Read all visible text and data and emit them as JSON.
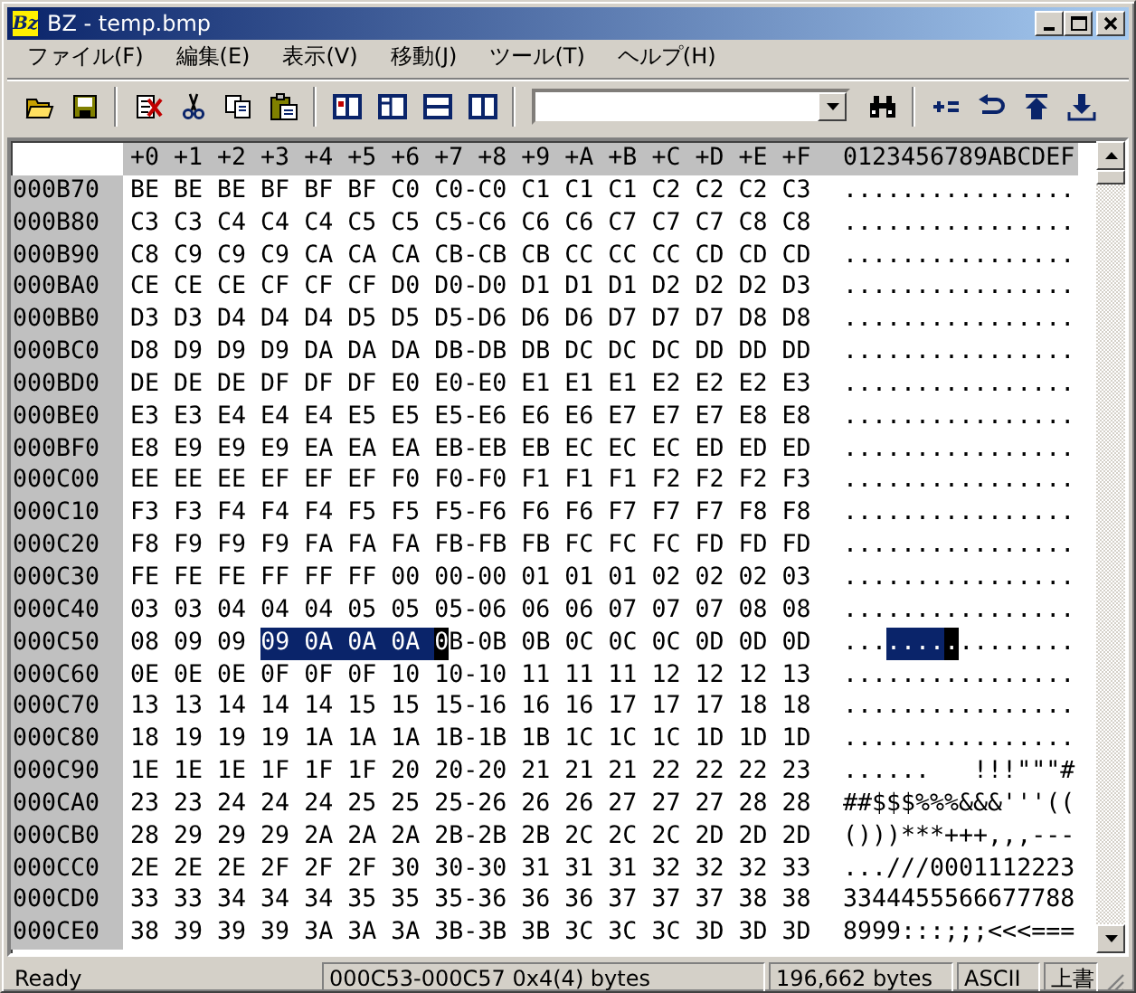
{
  "window": {
    "icon_label": "Bz",
    "title": "BZ - temp.bmp"
  },
  "menu": [
    {
      "label": "ファイル(F)"
    },
    {
      "label": "編集(E)"
    },
    {
      "label": "表示(V)"
    },
    {
      "label": "移動(J)"
    },
    {
      "label": "ツール(T)"
    },
    {
      "label": "ヘルプ(H)"
    }
  ],
  "hex_view": {
    "header": {
      "offsets": "+0 +1 +2 +3 +4 +5 +6 +7 +8 +9 +A +B +C +D +E +F",
      "ascii": "0123456789ABCDEF"
    },
    "rows": [
      {
        "address": "000B70",
        "hex": [
          {
            "kind": "plain",
            "text": "BE BE BE BF BF BF C0 C0-C0 C1 C1 C1 C2 C2 C2 C3"
          }
        ],
        "ascii": [
          {
            "kind": "plain",
            "text": "................"
          }
        ]
      },
      {
        "address": "000B80",
        "hex": [
          {
            "kind": "plain",
            "text": "C3 C3 C4 C4 C4 C5 C5 C5-C6 C6 C6 C7 C7 C7 C8 C8"
          }
        ],
        "ascii": [
          {
            "kind": "plain",
            "text": "................"
          }
        ]
      },
      {
        "address": "000B90",
        "hex": [
          {
            "kind": "plain",
            "text": "C8 C9 C9 C9 CA CA CA CB-CB CB CC CC CC CD CD CD"
          }
        ],
        "ascii": [
          {
            "kind": "plain",
            "text": "................"
          }
        ]
      },
      {
        "address": "000BA0",
        "hex": [
          {
            "kind": "plain",
            "text": "CE CE CE CF CF CF D0 D0-D0 D1 D1 D1 D2 D2 D2 D3"
          }
        ],
        "ascii": [
          {
            "kind": "plain",
            "text": "................"
          }
        ]
      },
      {
        "address": "000BB0",
        "hex": [
          {
            "kind": "plain",
            "text": "D3 D3 D4 D4 D4 D5 D5 D5-D6 D6 D6 D7 D7 D7 D8 D8"
          }
        ],
        "ascii": [
          {
            "kind": "plain",
            "text": "................"
          }
        ]
      },
      {
        "address": "000BC0",
        "hex": [
          {
            "kind": "plain",
            "text": "D8 D9 D9 D9 DA DA DA DB-DB DB DC DC DC DD DD DD"
          }
        ],
        "ascii": [
          {
            "kind": "plain",
            "text": "................"
          }
        ]
      },
      {
        "address": "000BD0",
        "hex": [
          {
            "kind": "plain",
            "text": "DE DE DE DF DF DF E0 E0-E0 E1 E1 E1 E2 E2 E2 E3"
          }
        ],
        "ascii": [
          {
            "kind": "plain",
            "text": "................"
          }
        ]
      },
      {
        "address": "000BE0",
        "hex": [
          {
            "kind": "plain",
            "text": "E3 E3 E4 E4 E4 E5 E5 E5-E6 E6 E6 E7 E7 E7 E8 E8"
          }
        ],
        "ascii": [
          {
            "kind": "plain",
            "text": "................"
          }
        ]
      },
      {
        "address": "000BF0",
        "hex": [
          {
            "kind": "plain",
            "text": "E8 E9 E9 E9 EA EA EA EB-EB EB EC EC EC ED ED ED"
          }
        ],
        "ascii": [
          {
            "kind": "plain",
            "text": "................"
          }
        ]
      },
      {
        "address": "000C00",
        "hex": [
          {
            "kind": "plain",
            "text": "EE EE EE EF EF EF F0 F0-F0 F1 F1 F1 F2 F2 F2 F3"
          }
        ],
        "ascii": [
          {
            "kind": "plain",
            "text": "................"
          }
        ]
      },
      {
        "address": "000C10",
        "hex": [
          {
            "kind": "plain",
            "text": "F3 F3 F4 F4 F4 F5 F5 F5-F6 F6 F6 F7 F7 F7 F8 F8"
          }
        ],
        "ascii": [
          {
            "kind": "plain",
            "text": "................"
          }
        ]
      },
      {
        "address": "000C20",
        "hex": [
          {
            "kind": "plain",
            "text": "F8 F9 F9 F9 FA FA FA FB-FB FB FC FC FC FD FD FD"
          }
        ],
        "ascii": [
          {
            "kind": "plain",
            "text": "................"
          }
        ]
      },
      {
        "address": "000C30",
        "hex": [
          {
            "kind": "plain",
            "text": "FE FE FE FF FF FF 00 00-00 01 01 01 02 02 02 03"
          }
        ],
        "ascii": [
          {
            "kind": "plain",
            "text": "................"
          }
        ]
      },
      {
        "address": "000C40",
        "hex": [
          {
            "kind": "plain",
            "text": "03 03 04 04 04 05 05 05-06 06 06 07 07 07 08 08"
          }
        ],
        "ascii": [
          {
            "kind": "plain",
            "text": "................"
          }
        ]
      },
      {
        "address": "000C50",
        "hex": [
          {
            "kind": "plain",
            "text": "08 09 09 "
          },
          {
            "kind": "selected",
            "text": "09 0A 0A 0A "
          },
          {
            "kind": "cursor",
            "text": "0"
          },
          {
            "kind": "plain",
            "text": "B-0B 0B 0C 0C 0C 0D 0D 0D"
          }
        ],
        "ascii": [
          {
            "kind": "plain",
            "text": "..."
          },
          {
            "kind": "selected",
            "text": "...."
          },
          {
            "kind": "cursor",
            "text": "."
          },
          {
            "kind": "plain",
            "text": "........"
          }
        ]
      },
      {
        "address": "000C60",
        "hex": [
          {
            "kind": "plain",
            "text": "0E 0E 0E 0F 0F 0F 10 10-10 11 11 11 12 12 12 13"
          }
        ],
        "ascii": [
          {
            "kind": "plain",
            "text": "................"
          }
        ]
      },
      {
        "address": "000C70",
        "hex": [
          {
            "kind": "plain",
            "text": "13 13 14 14 14 15 15 15-16 16 16 17 17 17 18 18"
          }
        ],
        "ascii": [
          {
            "kind": "plain",
            "text": "................"
          }
        ]
      },
      {
        "address": "000C80",
        "hex": [
          {
            "kind": "plain",
            "text": "18 19 19 19 1A 1A 1A 1B-1B 1B 1C 1C 1C 1D 1D 1D"
          }
        ],
        "ascii": [
          {
            "kind": "plain",
            "text": "................"
          }
        ]
      },
      {
        "address": "000C90",
        "hex": [
          {
            "kind": "plain",
            "text": "1E 1E 1E 1F 1F 1F 20 20-20 21 21 21 22 22 22 23"
          }
        ],
        "ascii": [
          {
            "kind": "plain",
            "text": "......   !!!\"\"\"#"
          }
        ]
      },
      {
        "address": "000CA0",
        "hex": [
          {
            "kind": "plain",
            "text": "23 23 24 24 24 25 25 25-26 26 26 27 27 27 28 28"
          }
        ],
        "ascii": [
          {
            "kind": "plain",
            "text": "##$$$%%%&&&'''(("
          }
        ]
      },
      {
        "address": "000CB0",
        "hex": [
          {
            "kind": "plain",
            "text": "28 29 29 29 2A 2A 2A 2B-2B 2B 2C 2C 2C 2D 2D 2D"
          }
        ],
        "ascii": [
          {
            "kind": "plain",
            "text": "()))***+++,,,---"
          }
        ]
      },
      {
        "address": "000CC0",
        "hex": [
          {
            "kind": "plain",
            "text": "2E 2E 2E 2F 2F 2F 30 30-30 31 31 31 32 32 32 33"
          }
        ],
        "ascii": [
          {
            "kind": "plain",
            "text": "...///0001112223"
          }
        ]
      },
      {
        "address": "000CD0",
        "hex": [
          {
            "kind": "plain",
            "text": "33 33 34 34 34 35 35 35-36 36 36 37 37 37 38 38"
          }
        ],
        "ascii": [
          {
            "kind": "plain",
            "text": "3344455566677788"
          }
        ]
      },
      {
        "address": "000CE0",
        "hex": [
          {
            "kind": "plain",
            "text": "38 39 39 39 3A 3A 3A 3B-3B 3B 3C 3C 3C 3D 3D 3D"
          }
        ],
        "ascii": [
          {
            "kind": "plain",
            "text": "8999:::;;;<<<==="
          }
        ]
      }
    ]
  },
  "status_bar": {
    "message": "Ready",
    "selection": "000C53-000C57 0x4(4) bytes",
    "size": "196,662 bytes",
    "encoding": "ASCII",
    "mode": "上書"
  }
}
